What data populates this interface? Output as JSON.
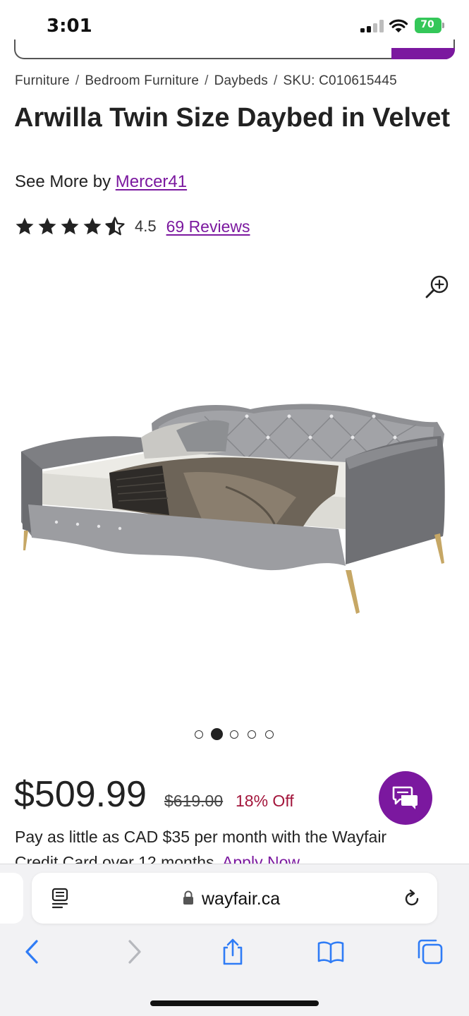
{
  "status": {
    "time": "3:01",
    "battery": "70"
  },
  "breadcrumb": [
    "Furniture",
    "Bedroom Furniture",
    "Daybeds",
    "SKU: C010615445"
  ],
  "product": {
    "title": "Arwilla Twin Size Daybed in Velvet",
    "see_more_prefix": "See More by ",
    "brand": "Mercer41",
    "rating": "4.5",
    "rating_stars": 4.5,
    "reviews": "69 Reviews",
    "price": "$509.99",
    "original_price": "$619.00",
    "discount": "18% Off",
    "financing": "Pay as little as CAD $35 per month with the Wayfair",
    "financing_cont": "Credit Card over 12 months.",
    "apply_now": "Apply Now"
  },
  "gallery": {
    "total": 5,
    "active_index": 1
  },
  "browser": {
    "url": "wayfair.ca"
  },
  "colors": {
    "brand_purple": "#7b189f",
    "discount_red": "#a3153b",
    "battery_green": "#34c759",
    "ios_blue": "#2f7cf6"
  },
  "icons": [
    "zoom-in-icon",
    "chat-icon",
    "reader-mode-icon",
    "lock-icon",
    "reload-icon",
    "back-icon",
    "forward-icon",
    "share-icon",
    "bookmarks-icon",
    "tabs-icon"
  ]
}
